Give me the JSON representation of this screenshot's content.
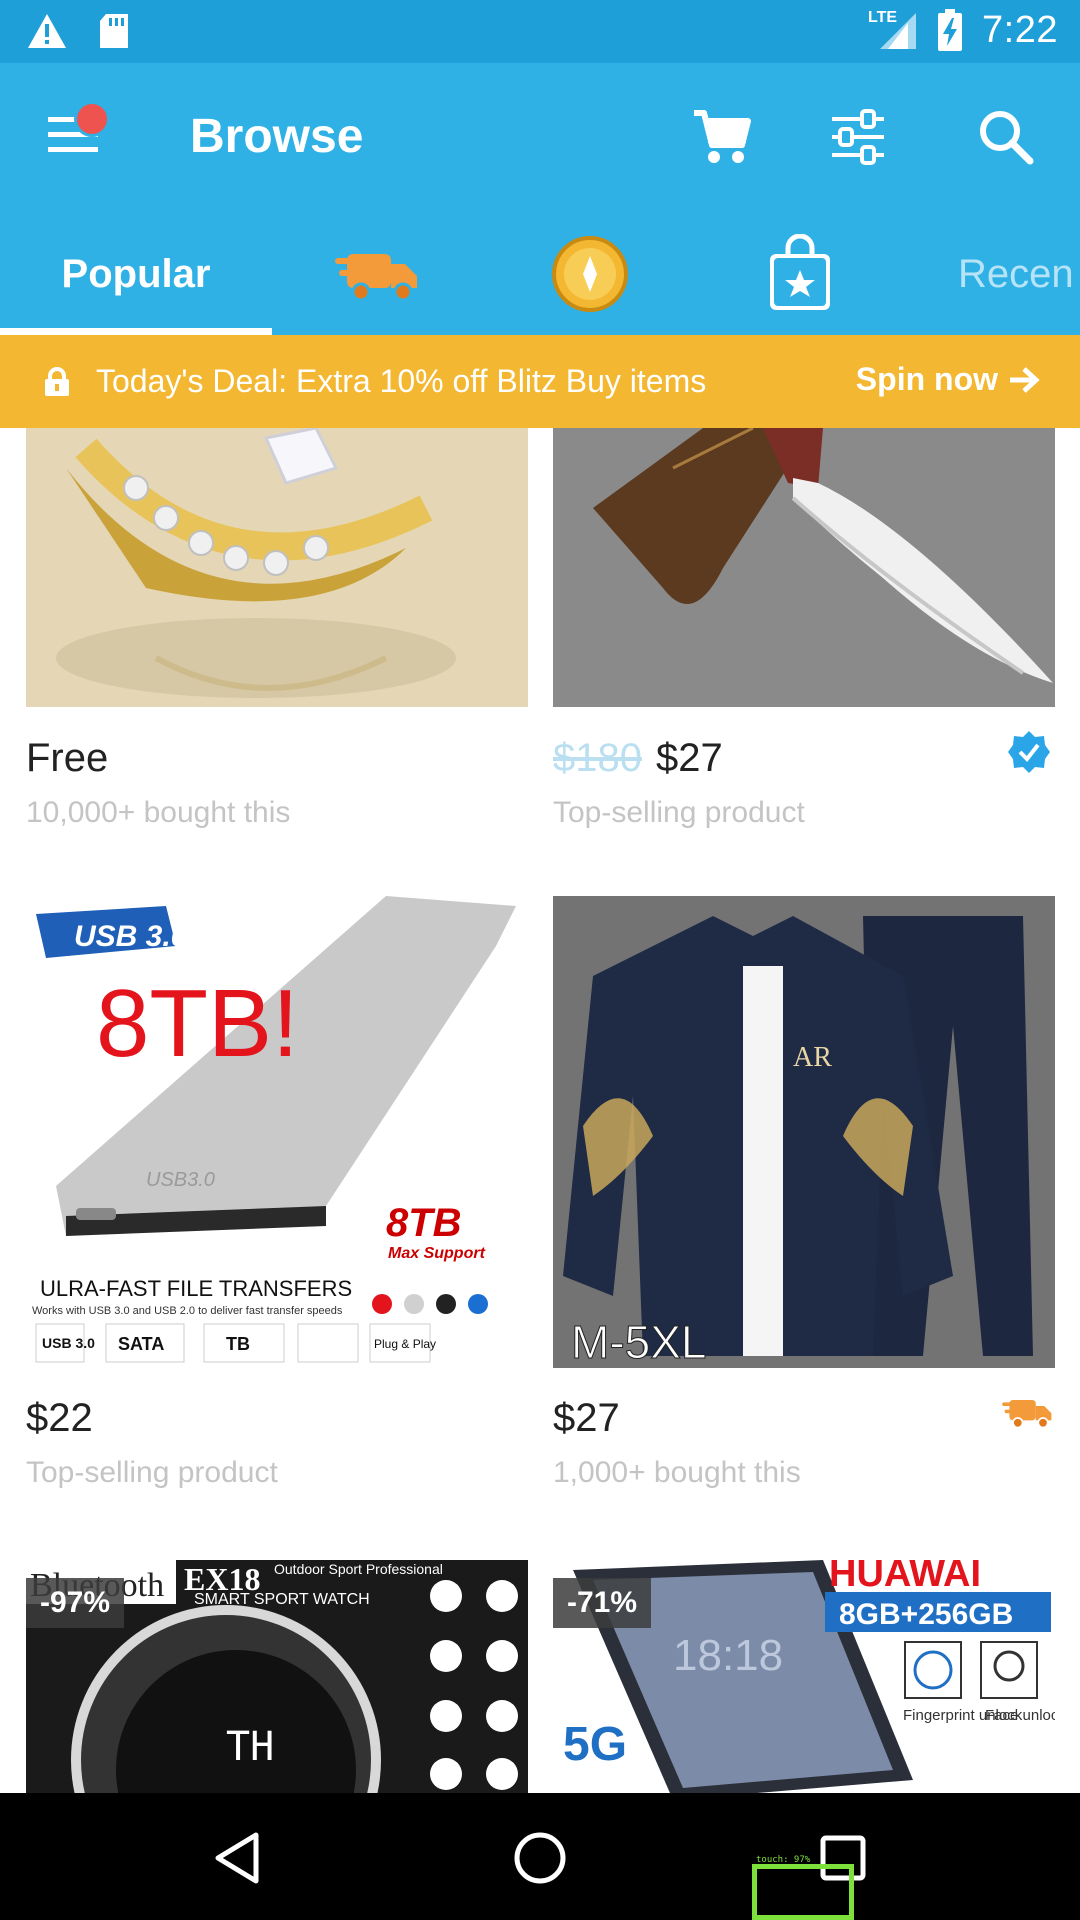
{
  "status_bar": {
    "network": "LTE",
    "time": "7:22",
    "icons": [
      "warning-icon",
      "sd-card-icon",
      "signal-icon",
      "battery-charging-icon"
    ]
  },
  "app_bar": {
    "title": "Browse",
    "icons": [
      "menu-icon",
      "cart-icon",
      "filter-icon",
      "search-icon"
    ],
    "notification_dot_color": "#ef5350"
  },
  "tabs": {
    "items": [
      {
        "label": "Popular",
        "selected": true
      },
      {
        "icon": "delivery-truck-icon"
      },
      {
        "icon": "coin-icon"
      },
      {
        "icon": "shopping-bag-star-icon"
      },
      {
        "label": "Recen"
      }
    ]
  },
  "deal_banner": {
    "text": "Today's Deal: Extra 10% off Blitz Buy items",
    "action": "Spin now"
  },
  "products": [
    {
      "price": "Free",
      "subtitle": "10,000+ bought this",
      "image": "gold-ring-image"
    },
    {
      "old_price": "$180",
      "price": "$27",
      "subtitle": "Top-selling product",
      "badge_icon": "verified-check-icon",
      "image": "knife-image"
    },
    {
      "price": "$22",
      "subtitle": "Top-selling product",
      "image": "hard-drive-image",
      "image_text": {
        "usb": "USB 3.0",
        "headline": "8TB!",
        "drive_label": "USB3.0",
        "support": "8TB",
        "support_sub": "Max Support",
        "transfer": "ULRA-FAST FILE TRANSFERS",
        "transfer_sub": "Works with USB 3.0 and USB 2.0 to deliver fast transfer speeds",
        "chip1": "USB 3.0",
        "chip2": "SATA",
        "chip3": "TB",
        "chip4": "Plug & Play"
      }
    },
    {
      "price": "$27",
      "subtitle": "1,000+ bought this",
      "badge_icon": "delivery-truck-icon",
      "image": "tracksuit-image",
      "image_text": {
        "size": "M-5XL",
        "brand": "AR"
      }
    },
    {
      "discount": "-97%",
      "image": "smart-watch-image",
      "image_text": {
        "top": "Bluetooth",
        "model": "EX18",
        "desc1": "Outdoor Sport Professional",
        "desc2": "SMART SPORT WATCH",
        "dial": "TH"
      }
    },
    {
      "discount": "-71%",
      "image": "huawei-phone-image",
      "image_text": {
        "brand": "HUAWAI",
        "spec": "8GB+256GB",
        "fp": "Fingerprint unlock",
        "face": "Face unlock",
        "net": "5G",
        "clock": "18:18"
      }
    }
  ],
  "nav_bar": {
    "icons": [
      "back-icon",
      "home-icon",
      "recents-icon"
    ]
  },
  "touch_overlay": {
    "label": "touch: 97%"
  },
  "colors": {
    "primary": "#2fb1e6",
    "status": "#1e9fd8",
    "deal": "#f3b731",
    "verified": "#2aa6e8",
    "truck": "#f39a3a"
  }
}
